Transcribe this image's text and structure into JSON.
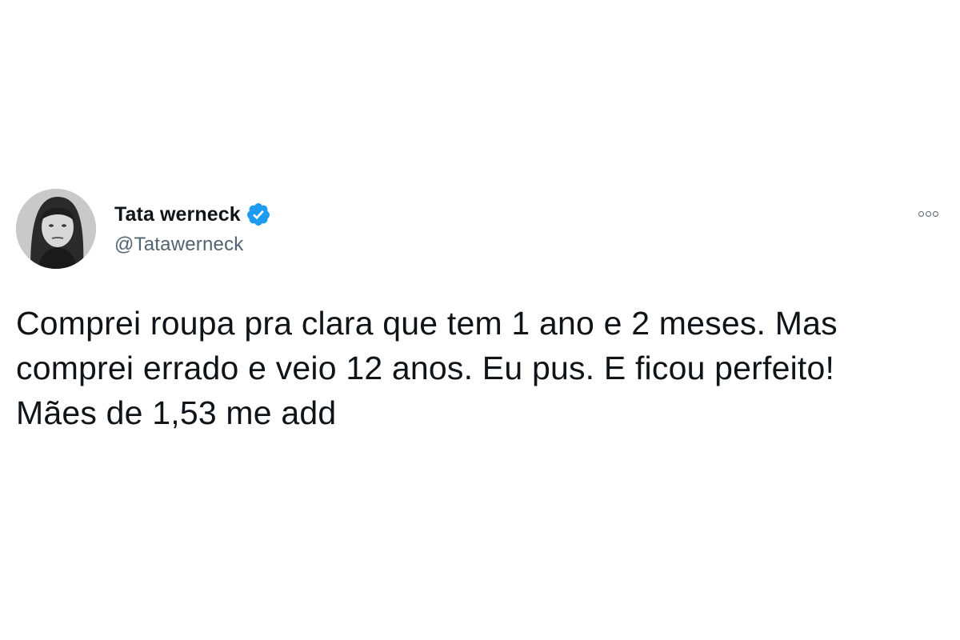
{
  "tweet": {
    "author": {
      "display_name": "Tata werneck",
      "handle": "@Tatawerneck",
      "verified_icon": "verified-badge-icon",
      "avatar": "profile-photo"
    },
    "more_icon": "more-options-icon",
    "text_lines": [
      "Comprei roupa pra clara que tem 1 ano e 2 meses. Mas",
      "comprei errado e veio 12 anos. Eu pus. E ficou perfeito!",
      "Mães de 1,53 me add"
    ]
  },
  "colors": {
    "text_primary": "#0f1419",
    "text_secondary": "#536471",
    "verified_blue": "#1d9bf0",
    "background": "#ffffff"
  }
}
